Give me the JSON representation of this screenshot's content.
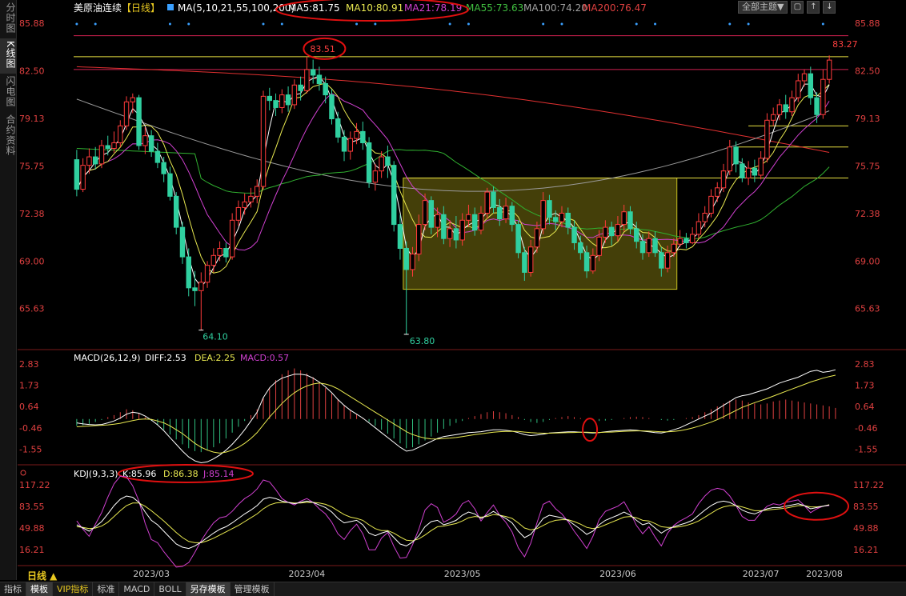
{
  "sidebar": {
    "tabs": [
      {
        "label": "分时图",
        "active": false
      },
      {
        "label": "K线图",
        "active": true
      },
      {
        "label": "闪电图",
        "active": false
      },
      {
        "label": "合约资料",
        "active": false
      }
    ]
  },
  "header": {
    "title": "美原油连续",
    "period": "【日线】",
    "ma_label": "MA(5,10,21,55,100,200)",
    "ma_values": [
      {
        "text": "MA5:81.75",
        "color": "#ffffff"
      },
      {
        "text": "MA10:80.91",
        "color": "#e8e850"
      },
      {
        "text": "MA21:78.19",
        "color": "#d040d0"
      },
      {
        "text": "MA55:73.63",
        "color": "#40c040"
      },
      {
        "text": "MA100:74.20",
        "color": "#a0a0a0"
      },
      {
        "text": "MA200:76.47",
        "color": "#e04040"
      }
    ],
    "theme_button": "全部主题▼",
    "icons": [
      "page-icon",
      "up-icon",
      "down-icon"
    ]
  },
  "main_axis": {
    "ticks": [
      "85.88",
      "82.50",
      "79.13",
      "75.75",
      "72.38",
      "69.00",
      "65.63"
    ],
    "tick_values": [
      85.88,
      82.5,
      79.13,
      75.75,
      72.38,
      69.0,
      65.63
    ]
  },
  "annotations": {
    "high_label": "83.51",
    "last_label": "83.27",
    "low1_label": "64.10",
    "low2_label": "63.80"
  },
  "macd": {
    "label": "MACD(26,12,9)",
    "diff": "DIFF:2.53",
    "dea": "DEA:2.25",
    "macd": "MACD:0.57",
    "ticks": [
      "2.83",
      "1.73",
      "0.64",
      "-0.46",
      "-1.55"
    ],
    "tick_values": [
      2.83,
      1.73,
      0.64,
      -0.46,
      -1.55
    ]
  },
  "kdj": {
    "label": "KDJ(9,3,3)",
    "k": "K:85.96",
    "d": "D:86.38",
    "j": "J:85.14",
    "ticks": [
      "117.22",
      "83.55",
      "49.88",
      "16.21"
    ],
    "tick_values": [
      117.22,
      83.55,
      49.88,
      16.21
    ]
  },
  "x_axis": {
    "period_button": "日线 ▲",
    "labels": [
      "2023/03",
      "2023/04",
      "2023/05",
      "2023/06",
      "2023/07",
      "2023/08"
    ]
  },
  "bottom_bar": [
    {
      "label": "指标",
      "active": false
    },
    {
      "label": "模板",
      "active": true
    },
    {
      "label": "VIP指标",
      "active": false,
      "vip": true
    },
    {
      "label": "标准",
      "active": false
    },
    {
      "label": "MACD",
      "active": false
    },
    {
      "label": "BOLL",
      "active": false
    },
    {
      "label": "另存模板",
      "active": true
    },
    {
      "label": "管理模板",
      "active": false
    }
  ],
  "chart_data": {
    "type": "candlestick",
    "instrument": "美原油连续",
    "period": "日线",
    "candles": [
      [
        76.2,
        74.1,
        76.9,
        73.6
      ],
      [
        74.1,
        75.8,
        76.3,
        73.9
      ],
      [
        75.8,
        76.4,
        77.0,
        75.2
      ],
      [
        76.4,
        75.9,
        77.1,
        75.5
      ],
      [
        75.9,
        77.2,
        77.6,
        75.6
      ],
      [
        77.2,
        77.0,
        77.9,
        76.5
      ],
      [
        77.0,
        77.4,
        78.2,
        76.7
      ],
      [
        77.4,
        78.6,
        79.0,
        77.1
      ],
      [
        78.6,
        80.3,
        80.7,
        78.3
      ],
      [
        80.3,
        80.6,
        80.9,
        79.5
      ],
      [
        80.6,
        77.2,
        80.8,
        76.9
      ],
      [
        77.2,
        77.9,
        78.5,
        76.6
      ],
      [
        77.9,
        76.8,
        78.3,
        76.4
      ],
      [
        76.8,
        76.0,
        77.4,
        75.6
      ],
      [
        76.0,
        75.2,
        76.4,
        74.6
      ],
      [
        75.2,
        73.6,
        75.7,
        73.3
      ],
      [
        73.6,
        71.4,
        73.9,
        70.9
      ],
      [
        71.4,
        69.3,
        71.8,
        68.8
      ],
      [
        69.3,
        67.1,
        69.9,
        66.5
      ],
      [
        67.1,
        66.9,
        68.3,
        65.8
      ],
      [
        66.9,
        67.5,
        68.2,
        64.1
      ],
      [
        67.5,
        68.7,
        69.0,
        67.1
      ],
      [
        68.7,
        69.4,
        69.9,
        68.2
      ],
      [
        69.4,
        69.9,
        70.4,
        69.0
      ],
      [
        69.9,
        69.3,
        70.3,
        68.9
      ],
      [
        69.3,
        71.9,
        72.4,
        69.1
      ],
      [
        71.9,
        72.8,
        73.3,
        71.5
      ],
      [
        72.8,
        73.2,
        73.8,
        72.3
      ],
      [
        73.2,
        73.6,
        74.2,
        72.8
      ],
      [
        73.6,
        74.3,
        74.8,
        73.1
      ],
      [
        74.3,
        80.7,
        81.1,
        74.1
      ],
      [
        80.7,
        80.4,
        81.3,
        79.7
      ],
      [
        80.4,
        79.9,
        80.9,
        79.3
      ],
      [
        79.9,
        80.8,
        81.2,
        79.5
      ],
      [
        80.8,
        80.1,
        81.4,
        79.6
      ],
      [
        80.1,
        81.5,
        81.9,
        79.8
      ],
      [
        81.5,
        81.1,
        82.1,
        80.4
      ],
      [
        81.1,
        82.6,
        83.51,
        80.9
      ],
      [
        82.6,
        82.2,
        83.3,
        81.6
      ],
      [
        82.2,
        81.6,
        82.8,
        81.1
      ],
      [
        81.6,
        80.8,
        82.1,
        80.2
      ],
      [
        80.8,
        79.1,
        81.2,
        78.7
      ],
      [
        79.1,
        77.8,
        79.6,
        77.4
      ],
      [
        77.8,
        76.8,
        78.3,
        76.1
      ],
      [
        76.8,
        77.7,
        78.2,
        76.2
      ],
      [
        77.7,
        78.2,
        78.8,
        77.3
      ],
      [
        78.2,
        77.4,
        78.9,
        76.9
      ],
      [
        77.4,
        74.6,
        77.8,
        74.2
      ],
      [
        74.6,
        75.4,
        75.9,
        74.0
      ],
      [
        75.4,
        76.4,
        76.8,
        74.9
      ],
      [
        76.4,
        75.8,
        77.2,
        74.9
      ],
      [
        75.8,
        71.6,
        76.1,
        71.1
      ],
      [
        71.6,
        69.9,
        72.3,
        69.1
      ],
      [
        69.9,
        68.4,
        70.4,
        63.8
      ],
      [
        68.4,
        69.5,
        70.0,
        67.9
      ],
      [
        69.5,
        71.6,
        72.3,
        69.0
      ],
      [
        71.6,
        73.3,
        73.8,
        71.2
      ],
      [
        73.3,
        71.4,
        73.6,
        70.9
      ],
      [
        71.4,
        72.3,
        72.8,
        70.7
      ],
      [
        72.3,
        70.6,
        72.9,
        70.2
      ],
      [
        70.6,
        71.3,
        71.9,
        70.0
      ],
      [
        71.3,
        70.5,
        72.2,
        69.9
      ],
      [
        70.5,
        71.9,
        72.4,
        70.1
      ],
      [
        71.9,
        72.3,
        73.0,
        71.4
      ],
      [
        72.3,
        71.2,
        72.8,
        70.8
      ],
      [
        71.2,
        72.4,
        72.9,
        70.9
      ],
      [
        72.4,
        73.9,
        74.2,
        72.0
      ],
      [
        73.9,
        72.8,
        74.3,
        72.4
      ],
      [
        72.8,
        72.0,
        73.4,
        71.5
      ],
      [
        72.0,
        72.9,
        73.5,
        71.7
      ],
      [
        72.9,
        71.6,
        73.2,
        71.1
      ],
      [
        71.6,
        69.6,
        71.9,
        69.2
      ],
      [
        69.6,
        68.2,
        70.0,
        67.6
      ],
      [
        68.2,
        70.0,
        70.5,
        67.9
      ],
      [
        70.0,
        71.3,
        71.8,
        69.6
      ],
      [
        71.3,
        73.3,
        73.9,
        70.9
      ],
      [
        73.3,
        72.1,
        73.7,
        71.6
      ],
      [
        72.1,
        71.8,
        72.6,
        71.2
      ],
      [
        71.8,
        72.4,
        72.9,
        71.4
      ],
      [
        72.4,
        71.4,
        72.8,
        70.9
      ],
      [
        71.4,
        70.3,
        71.9,
        69.8
      ],
      [
        70.3,
        69.6,
        70.8,
        69.1
      ],
      [
        69.6,
        68.3,
        70.1,
        67.8
      ],
      [
        68.3,
        69.4,
        69.9,
        68.1
      ],
      [
        69.4,
        70.7,
        71.2,
        69.0
      ],
      [
        70.7,
        71.4,
        71.9,
        70.3
      ],
      [
        71.4,
        70.8,
        71.8,
        70.1
      ],
      [
        70.8,
        71.6,
        72.2,
        70.4
      ],
      [
        71.6,
        72.5,
        73.0,
        71.1
      ],
      [
        72.5,
        71.3,
        72.9,
        70.9
      ],
      [
        71.3,
        70.4,
        71.8,
        69.9
      ],
      [
        70.4,
        69.6,
        70.9,
        69.1
      ],
      [
        69.6,
        70.6,
        71.1,
        69.3
      ],
      [
        70.6,
        69.6,
        71.1,
        69.3
      ],
      [
        69.6,
        68.5,
        70.0,
        67.9
      ],
      [
        68.5,
        69.6,
        70.1,
        68.2
      ],
      [
        69.6,
        70.2,
        70.6,
        69.3
      ],
      [
        70.2,
        70.6,
        71.2,
        70.0
      ],
      [
        70.6,
        70.3,
        71.0,
        69.9
      ],
      [
        70.3,
        70.9,
        71.4,
        70.2
      ],
      [
        70.9,
        71.8,
        72.4,
        70.6
      ],
      [
        71.8,
        72.4,
        72.9,
        71.4
      ],
      [
        72.4,
        73.6,
        74.1,
        72.1
      ],
      [
        73.6,
        74.2,
        74.6,
        73.2
      ],
      [
        74.2,
        75.4,
        75.9,
        73.9
      ],
      [
        75.4,
        77.1,
        77.6,
        75.1
      ],
      [
        77.1,
        75.9,
        77.5,
        75.3
      ],
      [
        75.9,
        74.9,
        76.3,
        74.6
      ],
      [
        74.9,
        75.6,
        76.1,
        74.4
      ],
      [
        75.6,
        75.1,
        76.2,
        74.6
      ],
      [
        75.1,
        76.3,
        76.8,
        74.8
      ],
      [
        76.3,
        79.0,
        79.5,
        76.0
      ],
      [
        79.0,
        79.4,
        79.9,
        78.6
      ],
      [
        79.4,
        80.1,
        80.5,
        79.0
      ],
      [
        80.1,
        79.6,
        80.8,
        79.1
      ],
      [
        79.6,
        80.6,
        81.1,
        79.3
      ],
      [
        80.6,
        81.8,
        82.3,
        80.3
      ],
      [
        81.8,
        82.3,
        82.6,
        81.4
      ],
      [
        82.3,
        80.6,
        82.8,
        80.1
      ],
      [
        80.6,
        79.4,
        81.0,
        78.8
      ],
      [
        79.4,
        81.9,
        82.6,
        79.1
      ],
      [
        81.9,
        83.27,
        83.6,
        81.6
      ]
    ],
    "macd_hist": [
      -0.35,
      -0.32,
      -0.25,
      -0.15,
      -0.05,
      0.1,
      0.2,
      0.35,
      0.5,
      0.45,
      0.3,
      0.1,
      -0.1,
      -0.3,
      -0.55,
      -0.8,
      -1.05,
      -1.3,
      -1.5,
      -1.65,
      -1.7,
      -1.6,
      -1.45,
      -1.25,
      -1.0,
      -0.7,
      -0.4,
      -0.1,
      0.2,
      0.5,
      1.1,
      1.6,
      2.0,
      2.3,
      2.5,
      2.6,
      2.5,
      2.35,
      2.15,
      1.9,
      1.6,
      1.3,
      1.0,
      0.7,
      0.45,
      0.25,
      0.05,
      -0.15,
      -0.35,
      -0.55,
      -0.75,
      -1.0,
      -1.25,
      -1.5,
      -1.45,
      -1.3,
      -1.1,
      -0.9,
      -0.7,
      -0.5,
      -0.35,
      -0.2,
      -0.1,
      0.05,
      0.15,
      0.25,
      0.35,
      0.4,
      0.35,
      0.3,
      0.2,
      0.1,
      -0.05,
      -0.15,
      -0.2,
      -0.15,
      -0.05,
      0.05,
      0.1,
      0.15,
      0.1,
      0.05,
      0.0,
      -0.05,
      -0.1,
      -0.08,
      -0.05,
      0.0,
      0.05,
      0.1,
      0.12,
      0.1,
      0.05,
      0.0,
      -0.05,
      -0.08,
      -0.05,
      0.0,
      0.05,
      0.1,
      0.2,
      0.35,
      0.5,
      0.65,
      0.8,
      0.95,
      1.0,
      0.95,
      0.85,
      0.8,
      0.75,
      0.8,
      0.9,
      0.95,
      1.0,
      0.95,
      0.9,
      0.85,
      0.8,
      0.75,
      0.7,
      0.65,
      0.57
    ],
    "diff": [
      -0.2,
      -0.25,
      -0.28,
      -0.3,
      -0.28,
      -0.2,
      -0.1,
      0.05,
      0.25,
      0.35,
      0.3,
      0.15,
      -0.05,
      -0.3,
      -0.6,
      -0.95,
      -1.3,
      -1.65,
      -1.95,
      -2.15,
      -2.25,
      -2.2,
      -2.05,
      -1.85,
      -1.6,
      -1.3,
      -0.95,
      -0.55,
      -0.1,
      0.35,
      1.1,
      1.6,
      1.9,
      2.1,
      2.2,
      2.3,
      2.3,
      2.25,
      2.1,
      1.9,
      1.65,
      1.35,
      1.0,
      0.7,
      0.45,
      0.25,
      0.05,
      -0.2,
      -0.45,
      -0.7,
      -0.95,
      -1.2,
      -1.45,
      -1.65,
      -1.6,
      -1.45,
      -1.3,
      -1.15,
      -1.0,
      -0.9,
      -0.85,
      -0.8,
      -0.75,
      -0.7,
      -0.68,
      -0.65,
      -0.6,
      -0.55,
      -0.55,
      -0.58,
      -0.62,
      -0.7,
      -0.8,
      -0.85,
      -0.82,
      -0.78,
      -0.72,
      -0.7,
      -0.68,
      -0.66,
      -0.66,
      -0.68,
      -0.7,
      -0.72,
      -0.7,
      -0.66,
      -0.62,
      -0.6,
      -0.58,
      -0.56,
      -0.58,
      -0.62,
      -0.66,
      -0.7,
      -0.72,
      -0.65,
      -0.55,
      -0.45,
      -0.3,
      -0.15,
      0.0,
      0.15,
      0.3,
      0.5,
      0.7,
      0.9,
      1.1,
      1.2,
      1.25,
      1.35,
      1.45,
      1.55,
      1.7,
      1.85,
      1.95,
      2.05,
      2.15,
      2.3,
      2.45,
      2.5,
      2.4,
      2.45,
      2.53
    ],
    "dea": [
      -0.4,
      -0.38,
      -0.36,
      -0.34,
      -0.32,
      -0.3,
      -0.27,
      -0.22,
      -0.15,
      -0.08,
      -0.02,
      0.0,
      -0.02,
      -0.1,
      -0.2,
      -0.35,
      -0.55,
      -0.75,
      -1.0,
      -1.25,
      -1.45,
      -1.6,
      -1.7,
      -1.75,
      -1.7,
      -1.6,
      -1.45,
      -1.25,
      -1.0,
      -0.7,
      -0.3,
      0.1,
      0.45,
      0.8,
      1.1,
      1.35,
      1.55,
      1.7,
      1.8,
      1.85,
      1.8,
      1.7,
      1.55,
      1.35,
      1.15,
      0.95,
      0.75,
      0.55,
      0.35,
      0.15,
      -0.05,
      -0.25,
      -0.45,
      -0.65,
      -0.8,
      -0.9,
      -0.98,
      -1.02,
      -1.03,
      -1.0,
      -0.98,
      -0.95,
      -0.9,
      -0.85,
      -0.8,
      -0.76,
      -0.72,
      -0.68,
      -0.65,
      -0.64,
      -0.63,
      -0.64,
      -0.67,
      -0.7,
      -0.72,
      -0.73,
      -0.73,
      -0.72,
      -0.71,
      -0.7,
      -0.69,
      -0.68,
      -0.68,
      -0.69,
      -0.69,
      -0.68,
      -0.67,
      -0.65,
      -0.63,
      -0.62,
      -0.61,
      -0.61,
      -0.62,
      -0.64,
      -0.66,
      -0.66,
      -0.64,
      -0.6,
      -0.54,
      -0.46,
      -0.37,
      -0.27,
      -0.16,
      -0.03,
      0.12,
      0.28,
      0.44,
      0.6,
      0.72,
      0.84,
      0.95,
      1.06,
      1.18,
      1.3,
      1.42,
      1.54,
      1.66,
      1.78,
      1.9,
      2.0,
      2.1,
      2.18,
      2.25
    ],
    "k": [
      55,
      50,
      45,
      52,
      60,
      72,
      85,
      95,
      100,
      98,
      90,
      75,
      62,
      55,
      45,
      35,
      25,
      20,
      18,
      22,
      28,
      35,
      42,
      48,
      52,
      58,
      65,
      72,
      78,
      85,
      95,
      98,
      96,
      92,
      90,
      88,
      90,
      92,
      90,
      86,
      82,
      75,
      65,
      58,
      60,
      62,
      55,
      42,
      38,
      42,
      45,
      35,
      25,
      22,
      28,
      38,
      52,
      60,
      62,
      55,
      58,
      62,
      70,
      75,
      72,
      65,
      70,
      76,
      70,
      65,
      58,
      45,
      35,
      40,
      52,
      65,
      70,
      68,
      66,
      62,
      55,
      48,
      40,
      45,
      55,
      62,
      66,
      70,
      75,
      70,
      62,
      55,
      58,
      50,
      42,
      48,
      52,
      55,
      58,
      62,
      70,
      78,
      85,
      90,
      92,
      90,
      85,
      78,
      74,
      72,
      76,
      80,
      82,
      82,
      84,
      86,
      88,
      85,
      80,
      82,
      84,
      85.96
    ],
    "d": [
      52,
      51,
      49,
      50,
      53,
      59,
      68,
      77,
      85,
      89,
      89,
      84,
      77,
      69,
      61,
      52,
      43,
      35,
      29,
      27,
      27,
      30,
      34,
      39,
      44,
      49,
      54,
      60,
      66,
      72,
      80,
      86,
      89,
      90,
      90,
      89,
      89,
      90,
      90,
      89,
      87,
      83,
      77,
      71,
      67,
      65,
      62,
      55,
      49,
      46,
      46,
      42,
      36,
      31,
      30,
      33,
      39,
      46,
      52,
      53,
      55,
      57,
      61,
      66,
      68,
      67,
      68,
      71,
      70,
      68,
      65,
      58,
      50,
      47,
      49,
      54,
      59,
      62,
      63,
      63,
      60,
      56,
      51,
      49,
      51,
      55,
      59,
      63,
      67,
      68,
      66,
      62,
      61,
      57,
      52,
      51,
      51,
      52,
      54,
      57,
      61,
      67,
      73,
      79,
      83,
      85,
      85,
      83,
      80,
      77,
      77,
      78,
      79,
      80,
      81,
      83,
      85,
      85,
      83,
      83,
      84,
      86.38
    ],
    "j": [
      61,
      48,
      37,
      56,
      74,
      98,
      119,
      131,
      130,
      116,
      92,
      57,
      32,
      27,
      13,
      1,
      -11,
      -10,
      -4,
      12,
      30,
      45,
      58,
      66,
      68,
      76,
      87,
      96,
      102,
      111,
      125,
      122,
      110,
      96,
      90,
      86,
      92,
      96,
      90,
      80,
      72,
      59,
      41,
      32,
      46,
      56,
      41,
      16,
      16,
      34,
      43,
      21,
      3,
      4,
      24,
      48,
      78,
      88,
      82,
      59,
      64,
      72,
      88,
      93,
      80,
      61,
      74,
      86,
      70,
      59,
      44,
      19,
      5,
      26,
      58,
      87,
      92,
      80,
      72,
      60,
      45,
      32,
      18,
      37,
      63,
      76,
      80,
      84,
      91,
      74,
      54,
      41,
      52,
      36,
      22,
      42,
      54,
      61,
      66,
      72,
      88,
      100,
      109,
      112,
      110,
      100,
      85,
      68,
      62,
      62,
      74,
      84,
      88,
      86,
      90,
      92,
      94,
      85,
      74,
      80,
      84,
      85.14
    ]
  }
}
